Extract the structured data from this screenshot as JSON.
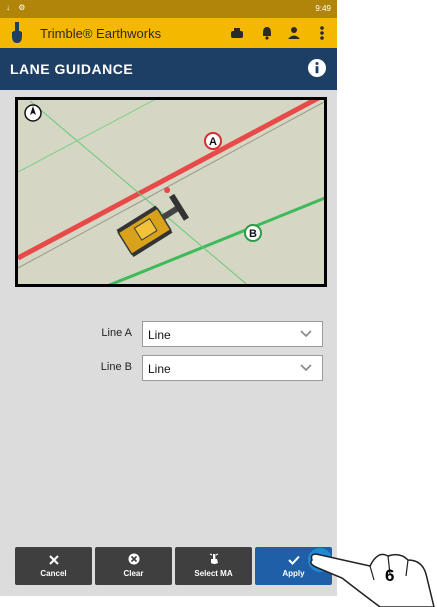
{
  "status_bar": {
    "left_icons": "↓ ⚙",
    "time": "9:49"
  },
  "app_bar": {
    "title": "Trimble® Earthworks",
    "icons": [
      "machine-icon",
      "bell-icon",
      "operator-icon",
      "more-vert-icon"
    ]
  },
  "header": {
    "title": "LANE GUIDANCE",
    "info_icon": "info-icon"
  },
  "map": {
    "compass_icon": "compass-icon",
    "line_a_marker": "A",
    "line_b_marker": "B",
    "colors": {
      "line_a": "#e84a4a",
      "line_b": "#3dbb5a",
      "ground": "#d5d6c4"
    }
  },
  "fields": {
    "line_a": {
      "label": "Line A",
      "value": "Line"
    },
    "line_b": {
      "label": "Line B",
      "value": "Line"
    }
  },
  "buttons": {
    "cancel": {
      "label": "Cancel",
      "icon": "close-icon"
    },
    "clear": {
      "label": "Clear",
      "icon": "clear-icon"
    },
    "select_ma": {
      "label": "Select MA",
      "icon": "tap-icon"
    },
    "apply": {
      "label": "Apply",
      "icon": "check-icon"
    }
  },
  "step_number": "6",
  "colors": {
    "app_bar": "#f5b800",
    "header": "#1d3f66",
    "apply": "#1f5fa8",
    "button": "#3f3f3f"
  }
}
